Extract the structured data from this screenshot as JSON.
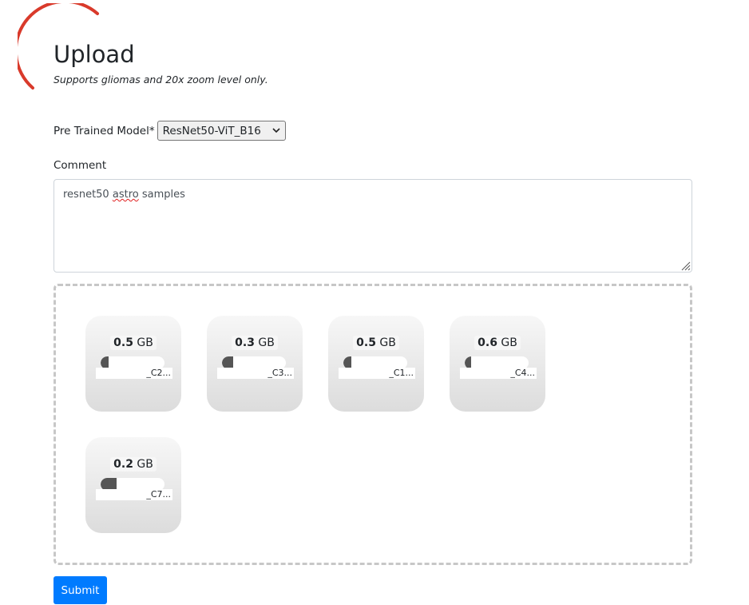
{
  "header": {
    "title": "Upload",
    "subtitle": "Supports gliomas and 20x zoom level only."
  },
  "form": {
    "model_label": "Pre Trained Model*",
    "model_value": "ResNet50-ViT_B16",
    "comment_label": "Comment",
    "comment_word1": "resnet50",
    "comment_word2": "astro",
    "comment_word3": "samples",
    "submit_label": "Submit"
  },
  "colors": {
    "accent": "#007bff",
    "spinner": "#d93a2b",
    "progress_fill": "#555555"
  },
  "files": [
    {
      "size_value": "0.5",
      "size_unit": "GB",
      "name": "_C2...",
      "progress": 0.12
    },
    {
      "size_value": "0.3",
      "size_unit": "GB",
      "name": "_C3...",
      "progress": 0.18
    },
    {
      "size_value": "0.5",
      "size_unit": "GB",
      "name": "_C1...",
      "progress": 0.12
    },
    {
      "size_value": "0.6",
      "size_unit": "GB",
      "name": "_C4...",
      "progress": 0.1
    },
    {
      "size_value": "0.2",
      "size_unit": "GB",
      "name": "_C7...",
      "progress": 0.25
    }
  ]
}
